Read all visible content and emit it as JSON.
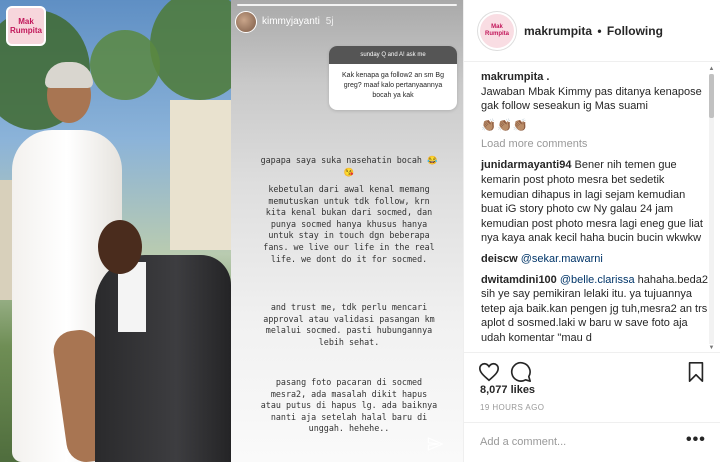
{
  "photo": {
    "logo_text": [
      "Mak",
      "Rumpita"
    ]
  },
  "story": {
    "username": "kimmyjayanti",
    "time": "5j",
    "question_header": "sunday Q and A! ask me",
    "question_text": "Kak kenapa ga follow2 an sm Bg greg? maaf kalo pertanyaannya bocah ya kak",
    "paragraphs": [
      "gapapa saya suka nasehatin bocah 😂😘",
      "kebetulan dari awal kenal memang memutuskan untuk tdk follow, krn kita kenal bukan dari socmed, dan punya socmed hanya khusus hanya untuk stay in touch dgn beberapa fans. we live our life in the real life. we dont do it for socmed.",
      "and trust me, tdk perlu mencari approval atau validasi pasangan km melalui socmed. pasti hubungannya lebih sehat.",
      "pasang foto pacaran di socmed mesra2, ada masalah dikit hapus atau putus di hapus lg. ada baiknya nanti aja setelah halal baru di unggah. hehehe.."
    ]
  },
  "panel": {
    "account": "makrumpita",
    "separator": "•",
    "follow_status": "Following",
    "avatar_text": "Mak Rumpita",
    "caption_user": "makrumpita .",
    "caption_text": "Jawaban Mbak Kimmy pas ditanya kenapose gak follow seseakun ig Mas suami",
    "caption_emoji": "👏🏽👏🏽👏🏽",
    "load_more": "Load more comments",
    "comments": [
      {
        "user": "junidarmayanti94",
        "text": "Bener nih temen gue kemarin post photo mesra bet sedetik kemudian dihapus in lagi sejam kemudian buat iG story photo cw Ny galau 24 jam kemudian post photo mesra lagi eneg gue liat nya kaya anak kecil haha bucin bucin wkwkw"
      },
      {
        "user": "deiscw",
        "mention": "@sekar.mawarni",
        "text": ""
      },
      {
        "user": "dwitamdini100",
        "mention": "@belle.clarissa",
        "text": "hahaha.beda2 sih ye say pemikiran lelaki itu. ya tujuannya tetep aja baik.kan pengen jg tuh,mesra2 an trs aplot d sosmed.laki w baru w save foto aja udah komentar \"mau d"
      }
    ],
    "likes": "8,077 likes",
    "time_ago": "19 HOURS AGO",
    "add_comment": "Add a comment...",
    "more": "•••"
  },
  "icons": {
    "send": "send-icon",
    "heart": "heart-icon",
    "comment": "comment-icon",
    "bookmark": "bookmark-icon"
  }
}
